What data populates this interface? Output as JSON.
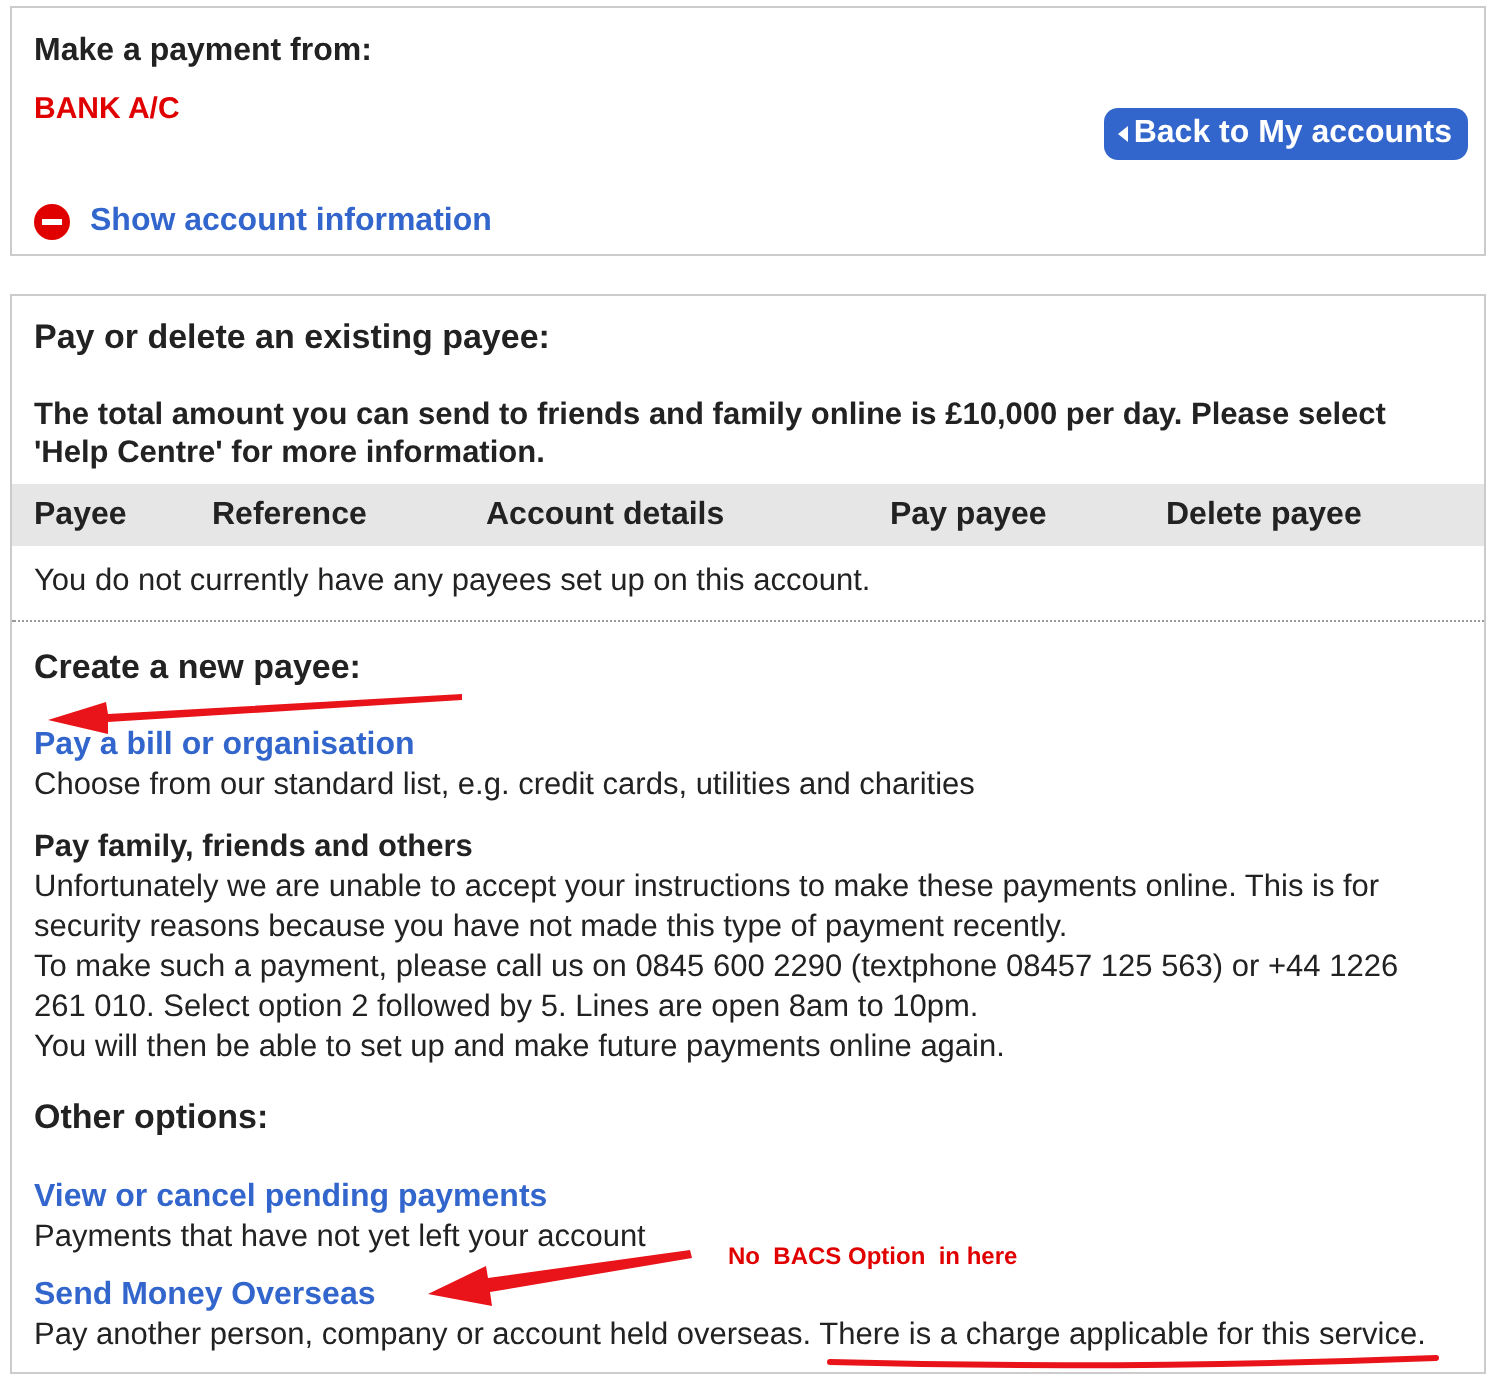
{
  "account_panel": {
    "title": "Make a payment from:",
    "account_name": "BANK A/C",
    "back_button": "Back to My accounts",
    "show_info_link": "Show account information"
  },
  "payees_panel": {
    "title": "Pay or delete an existing payee:",
    "notice": "The total amount you can send to friends and family online is £10,000 per day. Please select 'Help Centre' for more information.",
    "table": {
      "columns": [
        "Payee",
        "Reference",
        "Account details",
        "Pay payee",
        "Delete payee"
      ],
      "empty_message": "You do not currently have any payees set up on this account."
    }
  },
  "new_payee": {
    "title": "Create a new payee:",
    "options": [
      {
        "kind": "link",
        "title": "Pay a bill or organisation",
        "paragraphs": [
          "Choose from our standard list, e.g. credit cards, utilities and charities"
        ]
      },
      {
        "kind": "heading",
        "title": "Pay family, friends and others",
        "paragraphs": [
          "Unfortunately we are unable to accept your instructions to make these payments online. This is for security reasons because you have not made this type of payment recently.",
          "To make such a payment, please call us on 0845 600 2290 (textphone 08457 125 563) or +44 1226 261 010. Select option 2 followed by 5. Lines are open 8am to 10pm.",
          "You will then be able to set up and make future payments online again."
        ]
      }
    ]
  },
  "other_options": {
    "title": "Other options:",
    "options": [
      {
        "kind": "link",
        "title": "View or cancel pending payments",
        "paragraphs": [
          "Payments that have not yet left your account"
        ]
      },
      {
        "kind": "link",
        "title": "Send Money Overseas",
        "paragraphs": [
          "Pay another person, company or account held overseas. There is a charge applicable for this service."
        ]
      }
    ]
  },
  "annotation": {
    "note": "No  BACS Option  in here"
  }
}
